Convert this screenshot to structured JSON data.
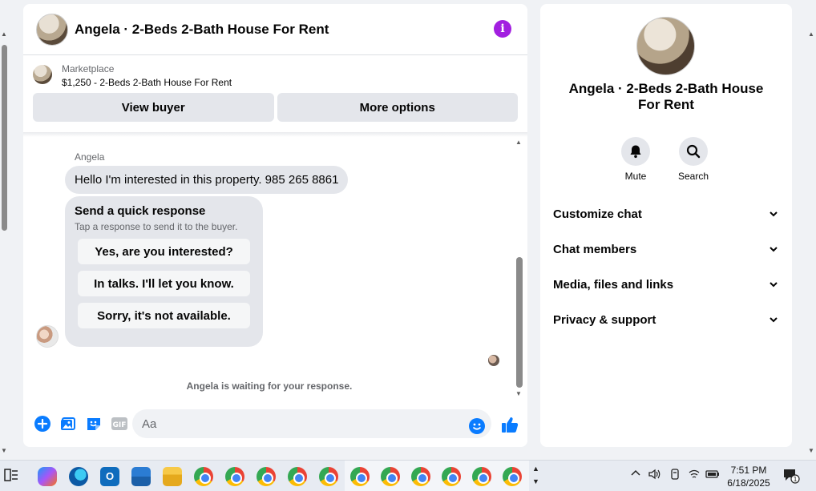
{
  "chat": {
    "title": "Angela · 2-Beds 2-Bath House For Rent",
    "info_icon": "info-icon",
    "marketplace_label": "Marketplace",
    "listing": "$1,250 - 2-Beds 2-Bath House For Rent",
    "view_buyer": "View buyer",
    "more_options": "More options"
  },
  "thread": {
    "sender": "Angela",
    "message": "Hello I'm interested in this property.  985 265 8861",
    "quick_title": "Send a quick response",
    "quick_subtitle": "Tap a response to send it to the buyer.",
    "quick_responses": [
      "Yes, are you interested?",
      "In talks. I'll let you know.",
      "Sorry, it's not available."
    ],
    "waiting": "Angela is waiting for your response."
  },
  "composer": {
    "placeholder": "Aa"
  },
  "side": {
    "title": "Angela · 2-Beds 2-Bath House For Rent",
    "mute": "Mute",
    "search": "Search",
    "sections": [
      "Customize chat",
      "Chat members",
      "Media, files and links",
      "Privacy & support"
    ]
  },
  "taskbar": {
    "time": "7:51 PM",
    "date": "6/18/2025"
  },
  "colors": {
    "accent": "#0a7cff",
    "info": "#a21fe0"
  }
}
